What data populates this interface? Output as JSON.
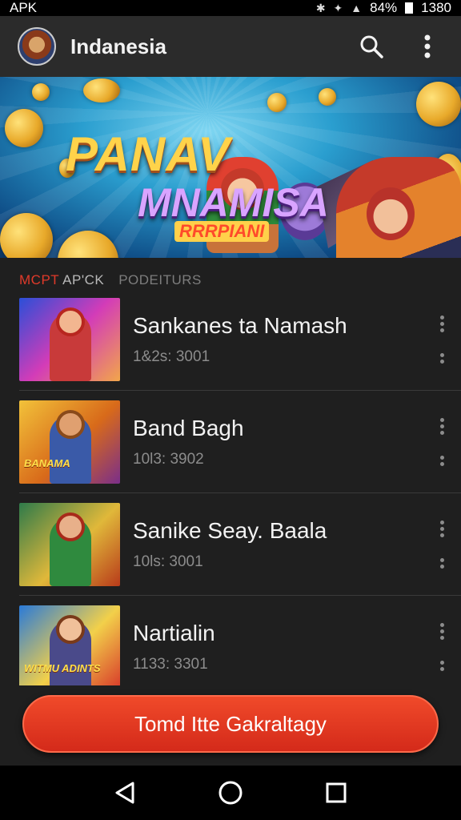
{
  "status_bar": {
    "carrier": "APK",
    "battery": "84%",
    "time": "1380"
  },
  "app_bar": {
    "title": "Indanesia"
  },
  "banner": {
    "title_line1": "PANAV",
    "title_line2": "MNAMISA",
    "subtitle": "RRRPIANI"
  },
  "tabs": [
    {
      "label_red": "MCPT",
      "label_grey": " AP'CK"
    },
    {
      "label": "PODEITURS"
    }
  ],
  "games": [
    {
      "title": "Sankanes ta Namash",
      "meta": "1&2s: 3001",
      "thumb_text": ""
    },
    {
      "title": "Band Bagh",
      "meta": "10l3: 3902",
      "thumb_text": "BANAMA"
    },
    {
      "title": "Sanike Seay. Baala",
      "meta": "10ls: 3001",
      "thumb_text": ""
    },
    {
      "title": "Nartialin",
      "meta": "1133: 3301",
      "thumb_text": "WITMU ADINTS"
    }
  ],
  "cta": {
    "label": "Tomd Itte Gakraltagy"
  },
  "colors": {
    "accent": "#e03a2a",
    "background": "#1f1f1f",
    "app_bar": "#2b2b2b"
  }
}
